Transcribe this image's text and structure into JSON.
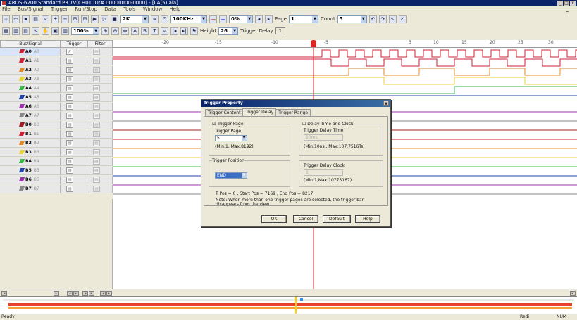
{
  "window": {
    "title": "ARDS-6200 Standard P3 1V(CH01 ID/# 00000000-0000) - [LA(5).ala]",
    "minimize": "_",
    "maximize": "□",
    "close": "x"
  },
  "menu": [
    "File",
    "Bus/Signal",
    "Trigger",
    "Run/Stop",
    "Data",
    "Tools",
    "Window",
    "Help"
  ],
  "toolbar": {
    "depth_value": "2K",
    "rate_value": "100KHz",
    "percent_value": "0%",
    "page_label": "Page",
    "page_value": "1",
    "count_label": "Count",
    "count_value": "5",
    "zoom_value": "100%",
    "height_label": "Height",
    "height_value": "26",
    "trigger_delay_label": "Trigger Delay",
    "trigger_delay_value": "1"
  },
  "table": {
    "col_bus_signal": "Bus/Signal",
    "col_trigger": "Trigger",
    "col_filter": "Filter",
    "rows": [
      {
        "name": "A0",
        "sub": "A0",
        "color": "#cc2233"
      },
      {
        "name": "A1",
        "sub": "A1",
        "color": "#cc2233"
      },
      {
        "name": "A2",
        "sub": "A2",
        "color": "#e08a2a"
      },
      {
        "name": "A3",
        "sub": "A3",
        "color": "#e8d23a"
      },
      {
        "name": "A4",
        "sub": "A4",
        "color": "#3cb84a"
      },
      {
        "name": "A5",
        "sub": "A5",
        "color": "#2244aa"
      },
      {
        "name": "A6",
        "sub": "A6",
        "color": "#9933aa"
      },
      {
        "name": "A7",
        "sub": "A7",
        "color": "#888888"
      },
      {
        "name": "B0",
        "sub": "B0",
        "color": "#a02222"
      },
      {
        "name": "B1",
        "sub": "B1",
        "color": "#cc2233"
      },
      {
        "name": "B2",
        "sub": "B2",
        "color": "#e08a2a"
      },
      {
        "name": "B3",
        "sub": "B3",
        "color": "#e8d23a"
      },
      {
        "name": "B4",
        "sub": "B4",
        "color": "#3cb84a"
      },
      {
        "name": "B5",
        "sub": "B5",
        "color": "#2244aa"
      },
      {
        "name": "B6",
        "sub": "B6",
        "color": "#9933aa"
      },
      {
        "name": "B7",
        "sub": "B7",
        "color": "#888888"
      }
    ]
  },
  "ruler_labels": [
    "-20",
    "-15",
    "-10",
    "-5",
    "5",
    "10",
    "15",
    "20",
    "25",
    "30"
  ],
  "dialog": {
    "title": "Trigger Property",
    "close": "x",
    "tabs": [
      "Trigger Content",
      "Trigger Delay",
      "Trigger Range"
    ],
    "trigger_page_check": "Trigger Page",
    "trigger_page_label": "Trigger Page",
    "trigger_page_value": "5",
    "trigger_page_hint": "(Min:1, Max:8192)",
    "delay_time_check": "Delay Time and Clock",
    "delay_time_label": "Trigger Delay Time",
    "delay_time_value": "10ms",
    "delay_time_hint": "(Min:10ns , Max:107.7516Ts)",
    "trigger_position_label": "Trigger Position",
    "trigger_position_value": "END",
    "delay_clock_label": "Trigger Delay Clock",
    "delay_clock_value": "1",
    "delay_clock_hint": "(Min:1,Max:10775167)",
    "pos_info": "T Pos = 0 , Start Pos = 7169 , End Pos = 8217",
    "note": "Note: When more than one trigger pages are selected, the trigger bar disappears from the view",
    "ok": "OK",
    "cancel": "Cancel",
    "default": "Default",
    "help": "Help"
  },
  "status": {
    "left": "Ready",
    "mode": "Redi",
    "num": "NUM"
  }
}
